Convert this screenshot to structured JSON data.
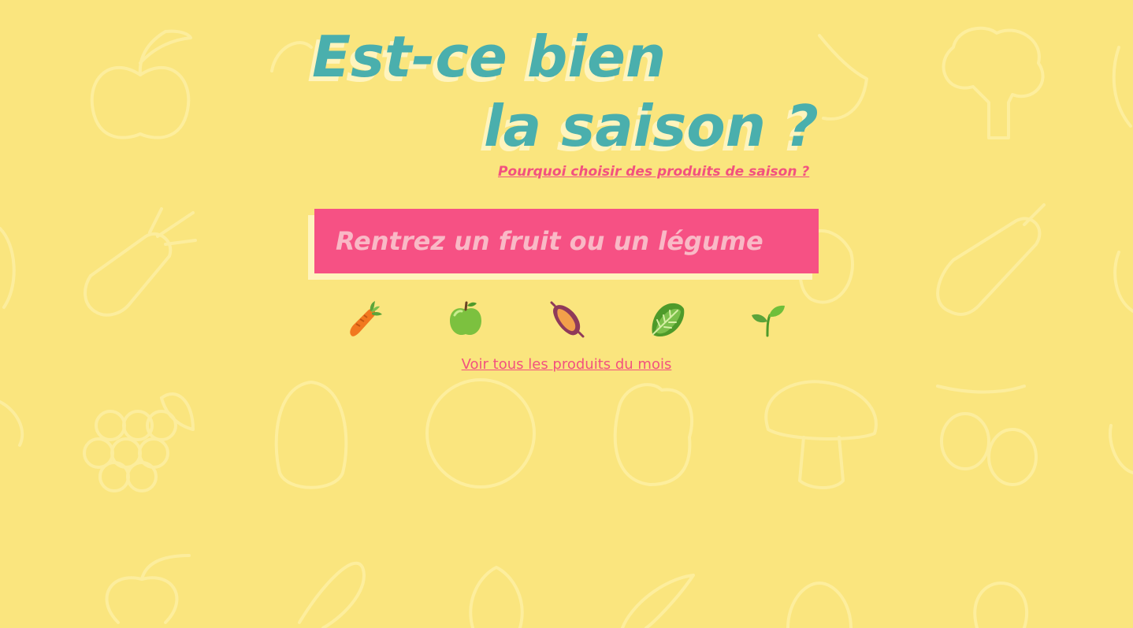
{
  "header": {
    "title_line_1": "Est-ce bien",
    "title_line_2": "la saison ?",
    "why_link": "Pourquoi choisir des produits de saison ?"
  },
  "search": {
    "placeholder": "Rentrez un fruit ou un légume",
    "value": ""
  },
  "suggestions": [
    {
      "name": "carrot-icon",
      "emoji": "🥕"
    },
    {
      "name": "green-apple-icon",
      "emoji": "🍏"
    },
    {
      "name": "sweet-potato-icon",
      "emoji": "🍠"
    },
    {
      "name": "leafy-green-icon",
      "emoji": "🥬"
    },
    {
      "name": "seedling-icon",
      "emoji": "🌱"
    }
  ],
  "footer": {
    "all_products_link": "Voir tous les produits du mois"
  },
  "colors": {
    "background": "#fae57e",
    "title": "#4aafad",
    "accent_pink": "#f65184",
    "shadow_cream": "#fff4bd"
  }
}
